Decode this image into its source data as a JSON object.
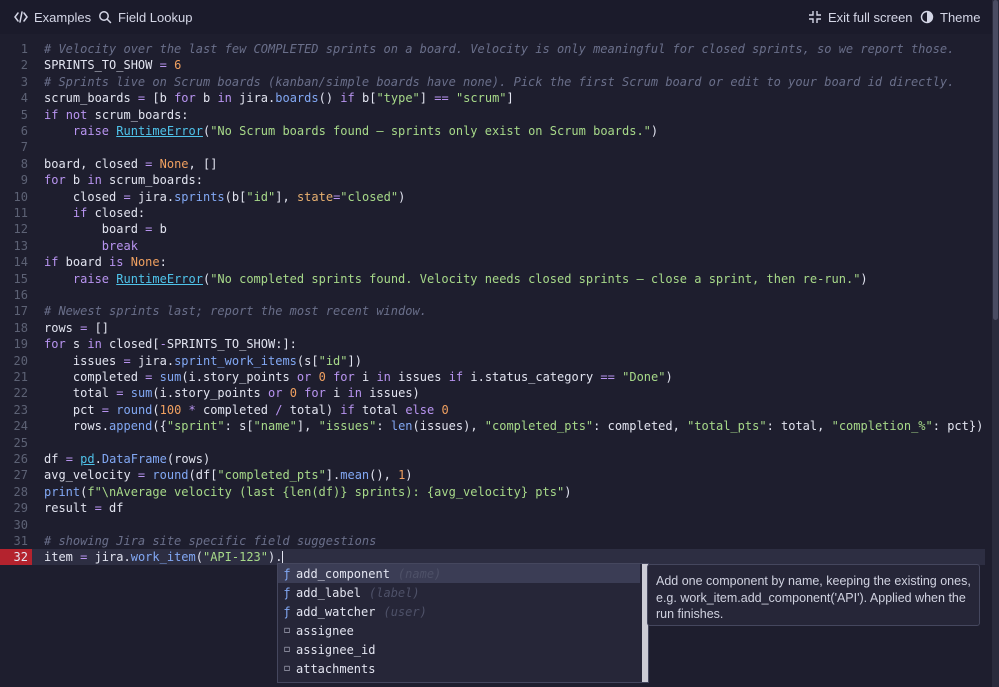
{
  "toolbar": {
    "examples_label": "Examples",
    "field_lookup_label": "Field Lookup",
    "exit_fullscreen_label": "Exit full screen",
    "theme_label": "Theme"
  },
  "editor": {
    "active_line": 32,
    "lines": [
      {
        "n": "1",
        "code": "# Velocity over the last few COMPLETED sprints on a board. Velocity is only meaningful for closed sprints, so we report those."
      },
      {
        "n": "2",
        "code": "SPRINTS_TO_SHOW = 6"
      },
      {
        "n": "3",
        "code": "# Sprints live on Scrum boards (kanban/simple boards have none). Pick the first Scrum board or edit to your board id directly."
      },
      {
        "n": "4",
        "code": "scrum_boards = [b for b in jira.boards() if b[\"type\"] == \"scrum\"]"
      },
      {
        "n": "5",
        "code": "if not scrum_boards:"
      },
      {
        "n": "6",
        "code": "    raise RuntimeError(\"No Scrum boards found — sprints only exist on Scrum boards.\")"
      },
      {
        "n": "7",
        "code": ""
      },
      {
        "n": "8",
        "code": "board, closed = None, []"
      },
      {
        "n": "9",
        "code": "for b in scrum_boards:"
      },
      {
        "n": "10",
        "code": "    closed = jira.sprints(b[\"id\"], state=\"closed\")"
      },
      {
        "n": "11",
        "code": "    if closed:"
      },
      {
        "n": "12",
        "code": "        board = b"
      },
      {
        "n": "13",
        "code": "        break"
      },
      {
        "n": "14",
        "code": "if board is None:"
      },
      {
        "n": "15",
        "code": "    raise RuntimeError(\"No completed sprints found. Velocity needs closed sprints — close a sprint, then re-run.\")"
      },
      {
        "n": "16",
        "code": ""
      },
      {
        "n": "17",
        "code": "# Newest sprints last; report the most recent window."
      },
      {
        "n": "18",
        "code": "rows = []"
      },
      {
        "n": "19",
        "code": "for s in closed[-SPRINTS_TO_SHOW:]:"
      },
      {
        "n": "20",
        "code": "    issues = jira.sprint_work_items(s[\"id\"])"
      },
      {
        "n": "21",
        "code": "    completed = sum(i.story_points or 0 for i in issues if i.status_category == \"Done\")"
      },
      {
        "n": "22",
        "code": "    total = sum(i.story_points or 0 for i in issues)"
      },
      {
        "n": "23",
        "code": "    pct = round(100 * completed / total) if total else 0"
      },
      {
        "n": "24",
        "code": "    rows.append({\"sprint\": s[\"name\"], \"issues\": len(issues), \"completed_pts\": completed, \"total_pts\": total, \"completion_%\": pct})"
      },
      {
        "n": "25",
        "code": ""
      },
      {
        "n": "26",
        "code": "df = pd.DataFrame(rows)"
      },
      {
        "n": "27",
        "code": "avg_velocity = round(df[\"completed_pts\"].mean(), 1)"
      },
      {
        "n": "28",
        "code": "print(f\"\\nAverage velocity (last {len(df)} sprints): {avg_velocity} pts\")"
      },
      {
        "n": "29",
        "code": "result = df"
      },
      {
        "n": "30",
        "code": ""
      },
      {
        "n": "31",
        "code": "# showing Jira site specific field suggestions"
      },
      {
        "n": "32",
        "code": "item = jira.work_item(\"API-123\")."
      }
    ]
  },
  "autocomplete": {
    "items": [
      {
        "kind": "function",
        "icon": "ƒ",
        "label": "add_component",
        "hint": "(name)"
      },
      {
        "kind": "function",
        "icon": "ƒ",
        "label": "add_label",
        "hint": "(label)"
      },
      {
        "kind": "function",
        "icon": "ƒ",
        "label": "add_watcher",
        "hint": "(user)"
      },
      {
        "kind": "property",
        "icon": "◻",
        "label": "assignee",
        "hint": ""
      },
      {
        "kind": "property",
        "icon": "◻",
        "label": "assignee_id",
        "hint": ""
      },
      {
        "kind": "property",
        "icon": "◻",
        "label": "attachments",
        "hint": ""
      }
    ],
    "doc": "Add one component by name, keeping the existing ones, e.g. work_item.add_component('API'). Applied when the run finishes."
  }
}
